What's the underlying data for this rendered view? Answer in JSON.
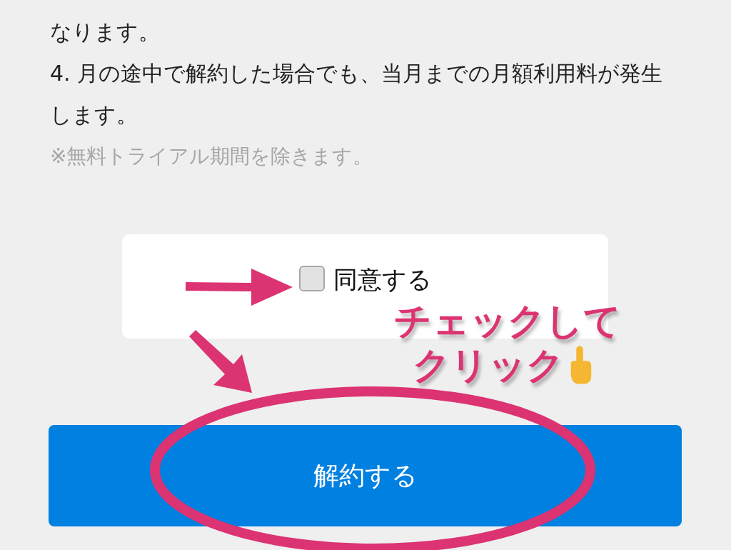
{
  "terms": [
    {
      "kind": "item",
      "text": "なります。"
    },
    {
      "kind": "item",
      "text": "4. 月の途中で解約した場合でも、当月までの月額利用料が発生します。"
    },
    {
      "kind": "note",
      "text": "※無料トライアル期間を除きます。"
    }
  ],
  "agreement": {
    "label": "同意する",
    "checked": false
  },
  "submit_button": {
    "label": "解約する"
  },
  "annotation": {
    "lines": [
      "チェックして",
      "クリック"
    ]
  }
}
